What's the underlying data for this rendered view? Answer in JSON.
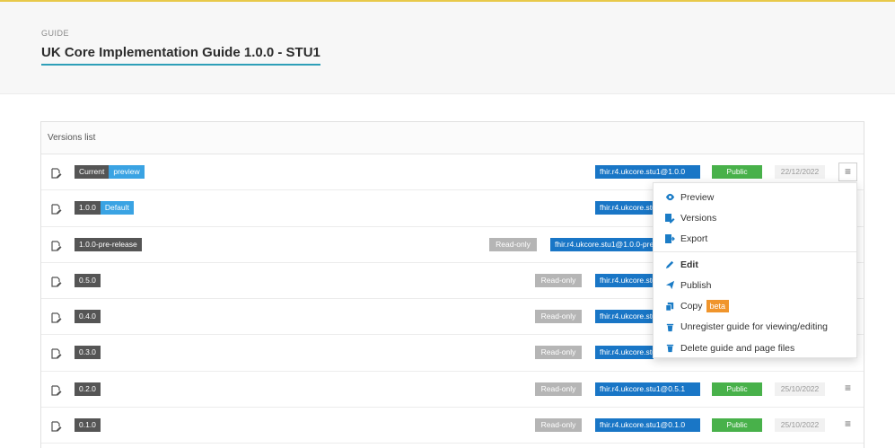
{
  "header": {
    "eyebrow": "GUIDE",
    "title": "UK Core Implementation Guide 1.0.0 - STU1"
  },
  "panel": {
    "title": "Versions list"
  },
  "rows": [
    {
      "tags": [
        {
          "text": "Current",
          "color": "dark"
        },
        {
          "text": "preview",
          "color": "blue"
        }
      ],
      "readonly": "",
      "package": "fhir.r4.ukcore.stu1@1.0.0",
      "status": "Public",
      "date": "22/12/2022"
    },
    {
      "tags": [
        {
          "text": "1.0.0",
          "color": "dark"
        },
        {
          "text": "Default",
          "color": "blue"
        }
      ],
      "readonly": "",
      "package": "fhir.r4.ukcore.stu1@1.0.0",
      "status": "",
      "date": ""
    },
    {
      "tags": [
        {
          "text": "1.0.0-pre-release",
          "color": "dark"
        }
      ],
      "readonly": "Read-only",
      "package": "fhir.r4.ukcore.stu1@1.0.0-pre-release",
      "status": "",
      "date": ""
    },
    {
      "tags": [
        {
          "text": "0.5.0",
          "color": "dark"
        }
      ],
      "readonly": "Read-only",
      "package": "fhir.r4.ukcore.stu1@0.5.0",
      "status": "",
      "date": ""
    },
    {
      "tags": [
        {
          "text": "0.4.0",
          "color": "dark"
        }
      ],
      "readonly": "Read-only",
      "package": "fhir.r4.ukcore.stu1@0.4.0",
      "status": "",
      "date": ""
    },
    {
      "tags": [
        {
          "text": "0.3.0",
          "color": "dark"
        }
      ],
      "readonly": "Read-only",
      "package": "fhir.r4.ukcore.stu1@0.3.0",
      "status": "",
      "date": ""
    },
    {
      "tags": [
        {
          "text": "0.2.0",
          "color": "dark"
        }
      ],
      "readonly": "Read-only",
      "package": "fhir.r4.ukcore.stu1@0.5.1",
      "status": "Public",
      "date": "25/10/2022"
    },
    {
      "tags": [
        {
          "text": "0.1.0",
          "color": "dark"
        }
      ],
      "readonly": "Read-only",
      "package": "fhir.r4.ukcore.stu1@0.1.0",
      "status": "Public",
      "date": "25/10/2022"
    }
  ],
  "menu_icon": "hamburger-icon",
  "dropdown": {
    "groups": [
      [
        {
          "label": "Preview",
          "icon": "eye-icon",
          "bold": false
        },
        {
          "label": "Versions",
          "icon": "versions-icon",
          "bold": false
        },
        {
          "label": "Export",
          "icon": "export-icon",
          "bold": false
        }
      ],
      [
        {
          "label": "Edit",
          "icon": "pencil-icon",
          "bold": true
        },
        {
          "label": "Publish",
          "icon": "send-icon",
          "bold": false
        },
        {
          "label": "Copy",
          "icon": "copy-icon",
          "bold": false,
          "badge": "beta"
        },
        {
          "label": "Unregister guide for viewing/editing",
          "icon": "trash-icon",
          "bold": false
        },
        {
          "label": "Delete guide and page files",
          "icon": "trash-icon",
          "bold": false
        }
      ]
    ]
  },
  "colors": {
    "accent_underline": "#2e9fb8",
    "package_blue": "#1976c6",
    "tag_blue": "#3aa3e3",
    "public_green": "#48b14a",
    "beta_orange": "#f0952c"
  }
}
